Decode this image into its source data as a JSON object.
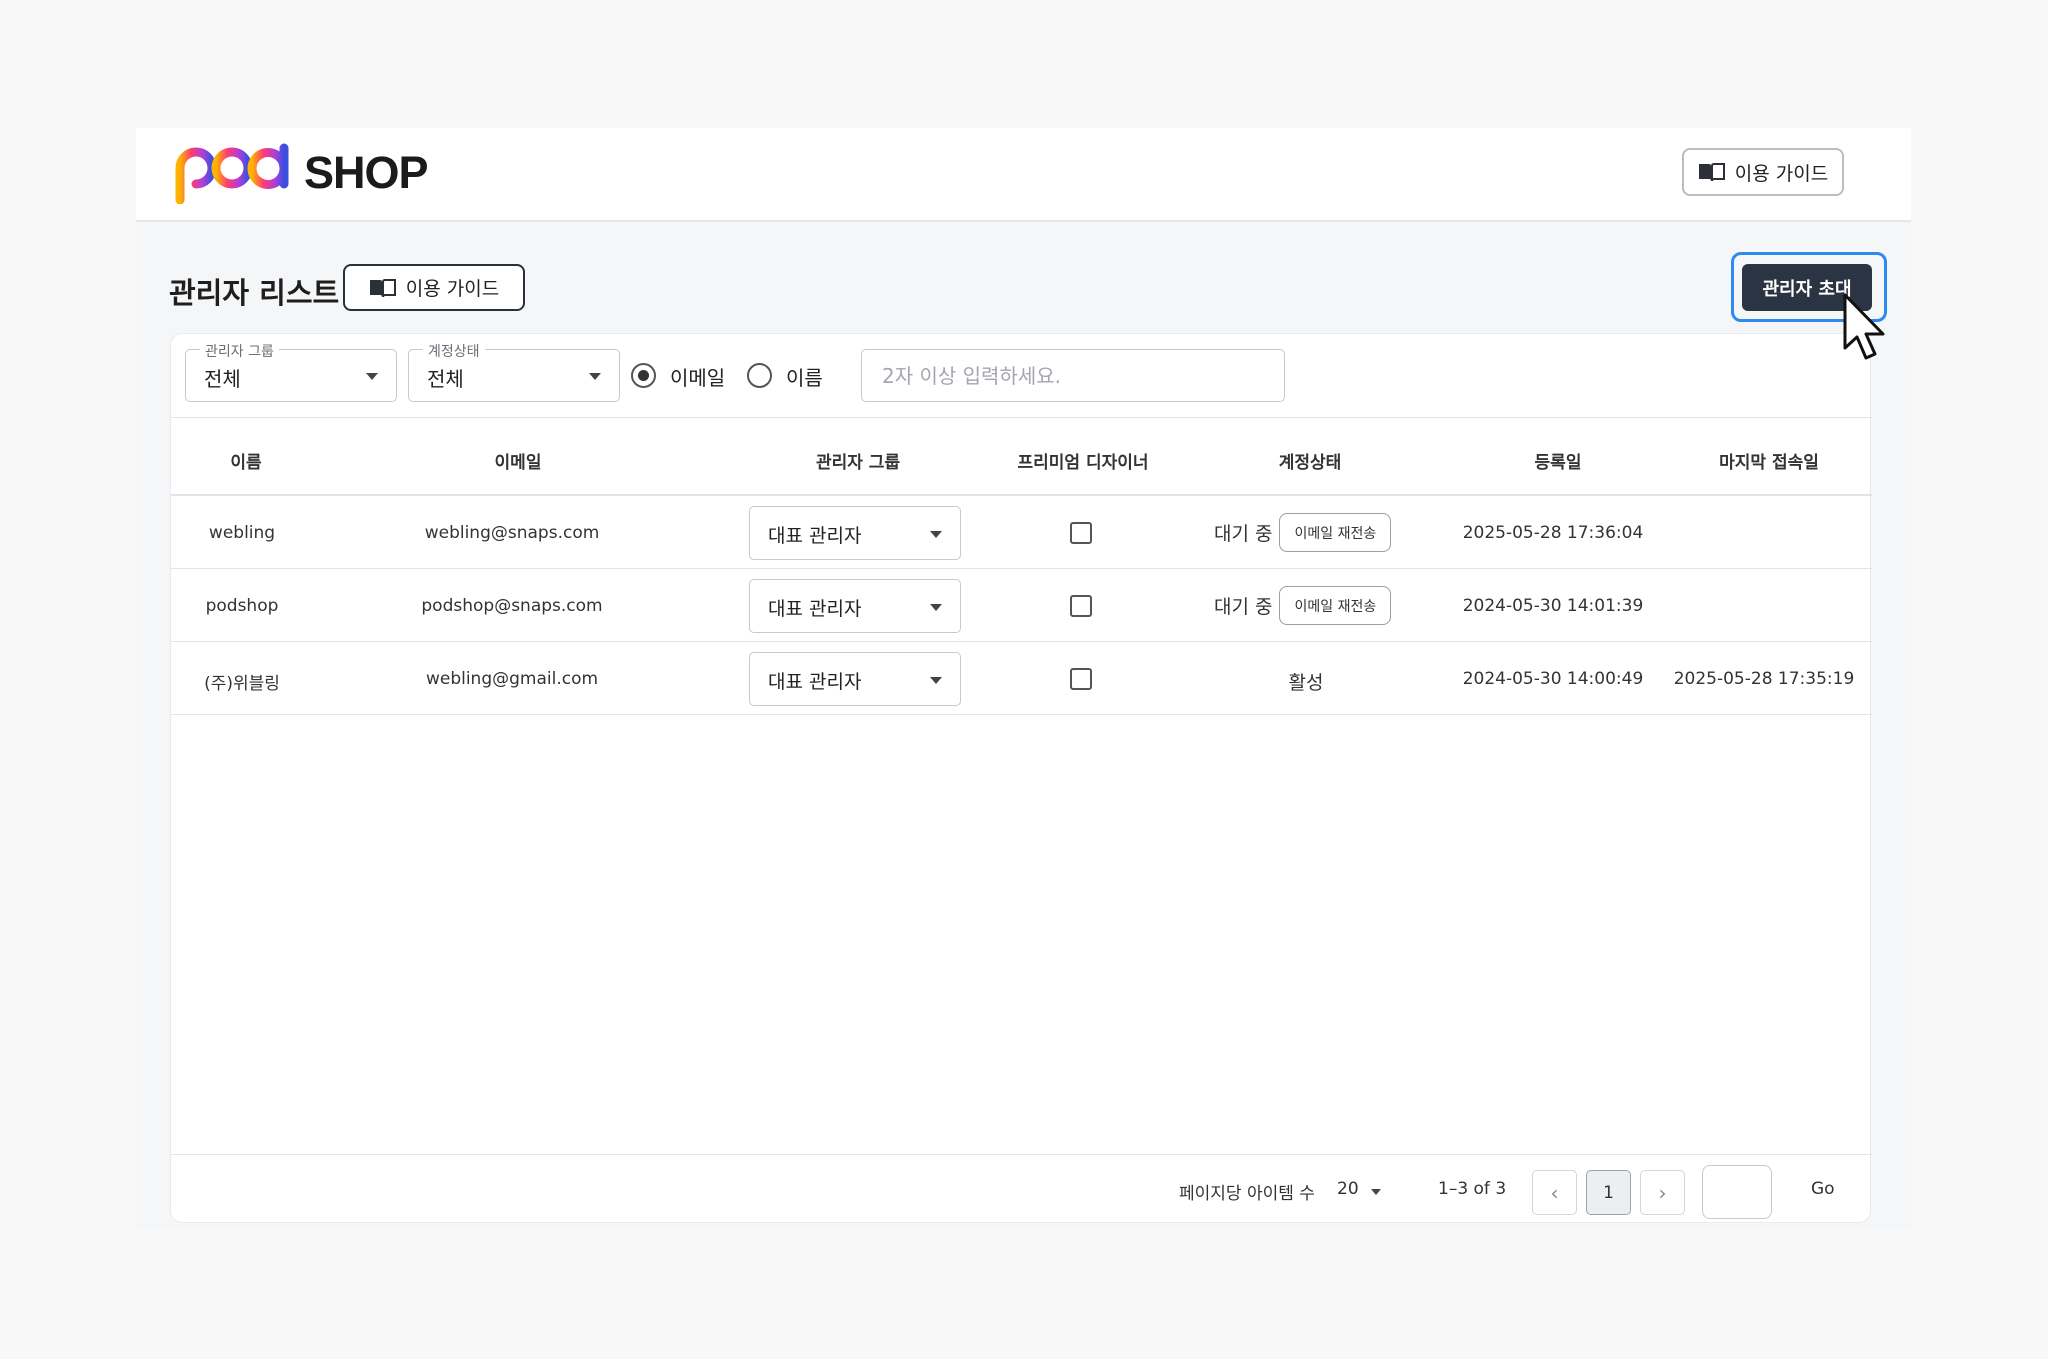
{
  "header": {
    "logo_pod": "pod",
    "logo_shop": "SHOP",
    "guide_label": "이용 가이드"
  },
  "page": {
    "title": "관리자 리스트",
    "guide_label": "이용 가이드",
    "invite_label": "관리자 초대"
  },
  "filters": {
    "group": {
      "legend": "관리자 그룹",
      "value": "전체"
    },
    "status": {
      "legend": "계정상태",
      "value": "전체"
    },
    "radio_options": [
      {
        "label": "이메일",
        "checked": true
      },
      {
        "label": "이름",
        "checked": false
      }
    ],
    "search_placeholder": "2자 이상 입력하세요."
  },
  "table": {
    "columns": [
      "이름",
      "이메일",
      "관리자 그룹",
      "프리미엄 디자이너",
      "계정상태",
      "등록일",
      "마지막 접속일"
    ],
    "rows": [
      {
        "name": "webling",
        "email": "webling@snaps.com",
        "group": "대표 관리자",
        "premium": false,
        "status": "대기 중",
        "resend": "이메일 재전송",
        "registered": "2025-05-28 17:36:04",
        "last_login": ""
      },
      {
        "name": "podshop",
        "email": "podshop@snaps.com",
        "group": "대표 관리자",
        "premium": false,
        "status": "대기 중",
        "resend": "이메일 재전송",
        "registered": "2024-05-30 14:01:39",
        "last_login": ""
      },
      {
        "name": "(주)위블링",
        "email": "webling@gmail.com",
        "group": "대표 관리자",
        "premium": false,
        "status": "활성",
        "resend": "",
        "registered": "2024-05-30 14:00:49",
        "last_login": "2025-05-28 17:35:19"
      }
    ]
  },
  "pagination": {
    "per_page_label": "페이지당 아이템 수",
    "per_page_value": "20",
    "range": "1–3 of 3",
    "current_page": "1",
    "prev_icon": "‹",
    "next_icon": "›",
    "go_label": "Go"
  },
  "colors": {
    "accent_focus": "#2d8af0",
    "primary_button": "#2b3442"
  }
}
